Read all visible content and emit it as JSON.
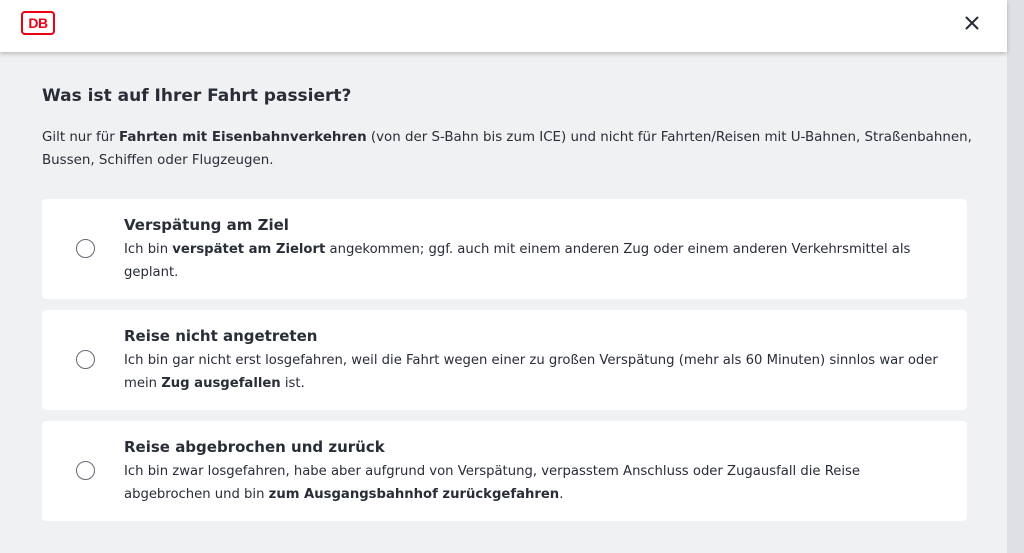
{
  "header": {
    "logo_text": "DB",
    "close_label": "×"
  },
  "page": {
    "title": "Was ist auf Ihrer Fahrt passiert?",
    "intro": {
      "prefix": "Gilt nur für ",
      "bold": "Fahrten mit Eisenbahnverkehren",
      "suffix": " (von der S-Bahn bis zum ICE) und nicht für Fahrten/Reisen mit U-Bahnen, Straßenbahnen, Bussen, Schiffen oder Flugzeugen."
    }
  },
  "options": [
    {
      "title": "Verspätung am Ziel",
      "text_before": "Ich bin ",
      "text_bold": "verspätet am Zielort",
      "text_after": " angekommen; ggf. auch mit einem anderen Zug oder einem anderen Verkehrsmittel als geplant.",
      "selected": false
    },
    {
      "title": "Reise nicht angetreten",
      "text_before": "Ich bin gar nicht erst losgefahren, weil die Fahrt wegen einer zu großen Verspätung (mehr als 60 Minuten) sinnlos war oder mein ",
      "text_bold": "Zug ausgefallen",
      "text_after": " ist.",
      "selected": false
    },
    {
      "title": "Reise abgebrochen und zurück",
      "text_before": "Ich bin zwar losgefahren, habe aber aufgrund von Verspätung, verpasstem Anschluss oder Zugausfall die Reise abgebrochen und bin ",
      "text_bold": "zum Ausgangsbahnhof zurückgefahren",
      "text_after": ".",
      "selected": false
    }
  ],
  "colors": {
    "brand_red": "#ec0016",
    "text": "#282d37",
    "background": "#f0f1f2"
  },
  "icons": {
    "close": "close-icon",
    "radio": "radio-unchecked-icon"
  }
}
